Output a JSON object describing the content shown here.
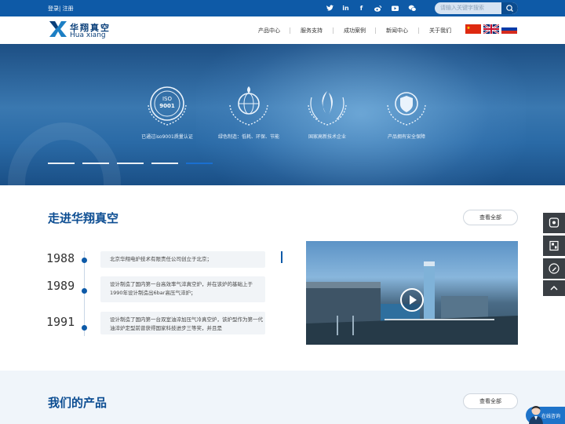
{
  "topbar": {
    "login": "登录",
    "sep": "|",
    "register": "注册",
    "social_icons": [
      "twitter-icon",
      "linkedin-icon",
      "facebook-icon",
      "weibo-icon",
      "youtube-icon",
      "wechat-icon"
    ],
    "search_placeholder": "请输入关键字搜索"
  },
  "logo": {
    "cn": "华翔真空",
    "en": "Hua xiang"
  },
  "nav": {
    "items": [
      "产品中心",
      "服务支持",
      "成功案例",
      "新闻中心",
      "关于我们"
    ],
    "flags": [
      "china-flag",
      "uk-flag",
      "russia-flag"
    ]
  },
  "banner": {
    "badges": [
      {
        "label": "已通过iso9001质量认证",
        "icon": "iso-9001-icon"
      },
      {
        "label": "绿色制造：低耗、环保、节能",
        "icon": "globe-leaf-icon"
      },
      {
        "label": "国家高新技术企业",
        "icon": "hitech-icon"
      },
      {
        "label": "产品拥有安全保障",
        "icon": "shield-icon"
      }
    ],
    "active_slide": 5,
    "slide_count": 5
  },
  "about": {
    "title": "走进华翔真空",
    "view_all": "查看全部",
    "timeline": [
      {
        "year": "1988",
        "text": "北京华翔电炉技术有限责任公司创立于北京；"
      },
      {
        "year": "1989",
        "text": "设计制造了国内第一台高效率气淬真空炉，并在该炉的基础上于1990年设计制造出6bar高压气淬炉；"
      },
      {
        "year": "1991",
        "text": "设计制造了国内第一台双室油淬加压气冷真空炉，该炉型作为第一代油淬炉定型前曾获得国家科技进步三等奖，并且是"
      }
    ]
  },
  "products": {
    "title": "我们的产品",
    "view_all": "查看全部"
  },
  "sidebar": {
    "icons": [
      "phone-icon",
      "qrcode-icon",
      "edit-icon",
      "arrow-up-icon"
    ]
  },
  "chat": {
    "label": "在线咨询"
  },
  "colors": {
    "brand": "#0e5aa7",
    "title": "#0c4d92"
  }
}
